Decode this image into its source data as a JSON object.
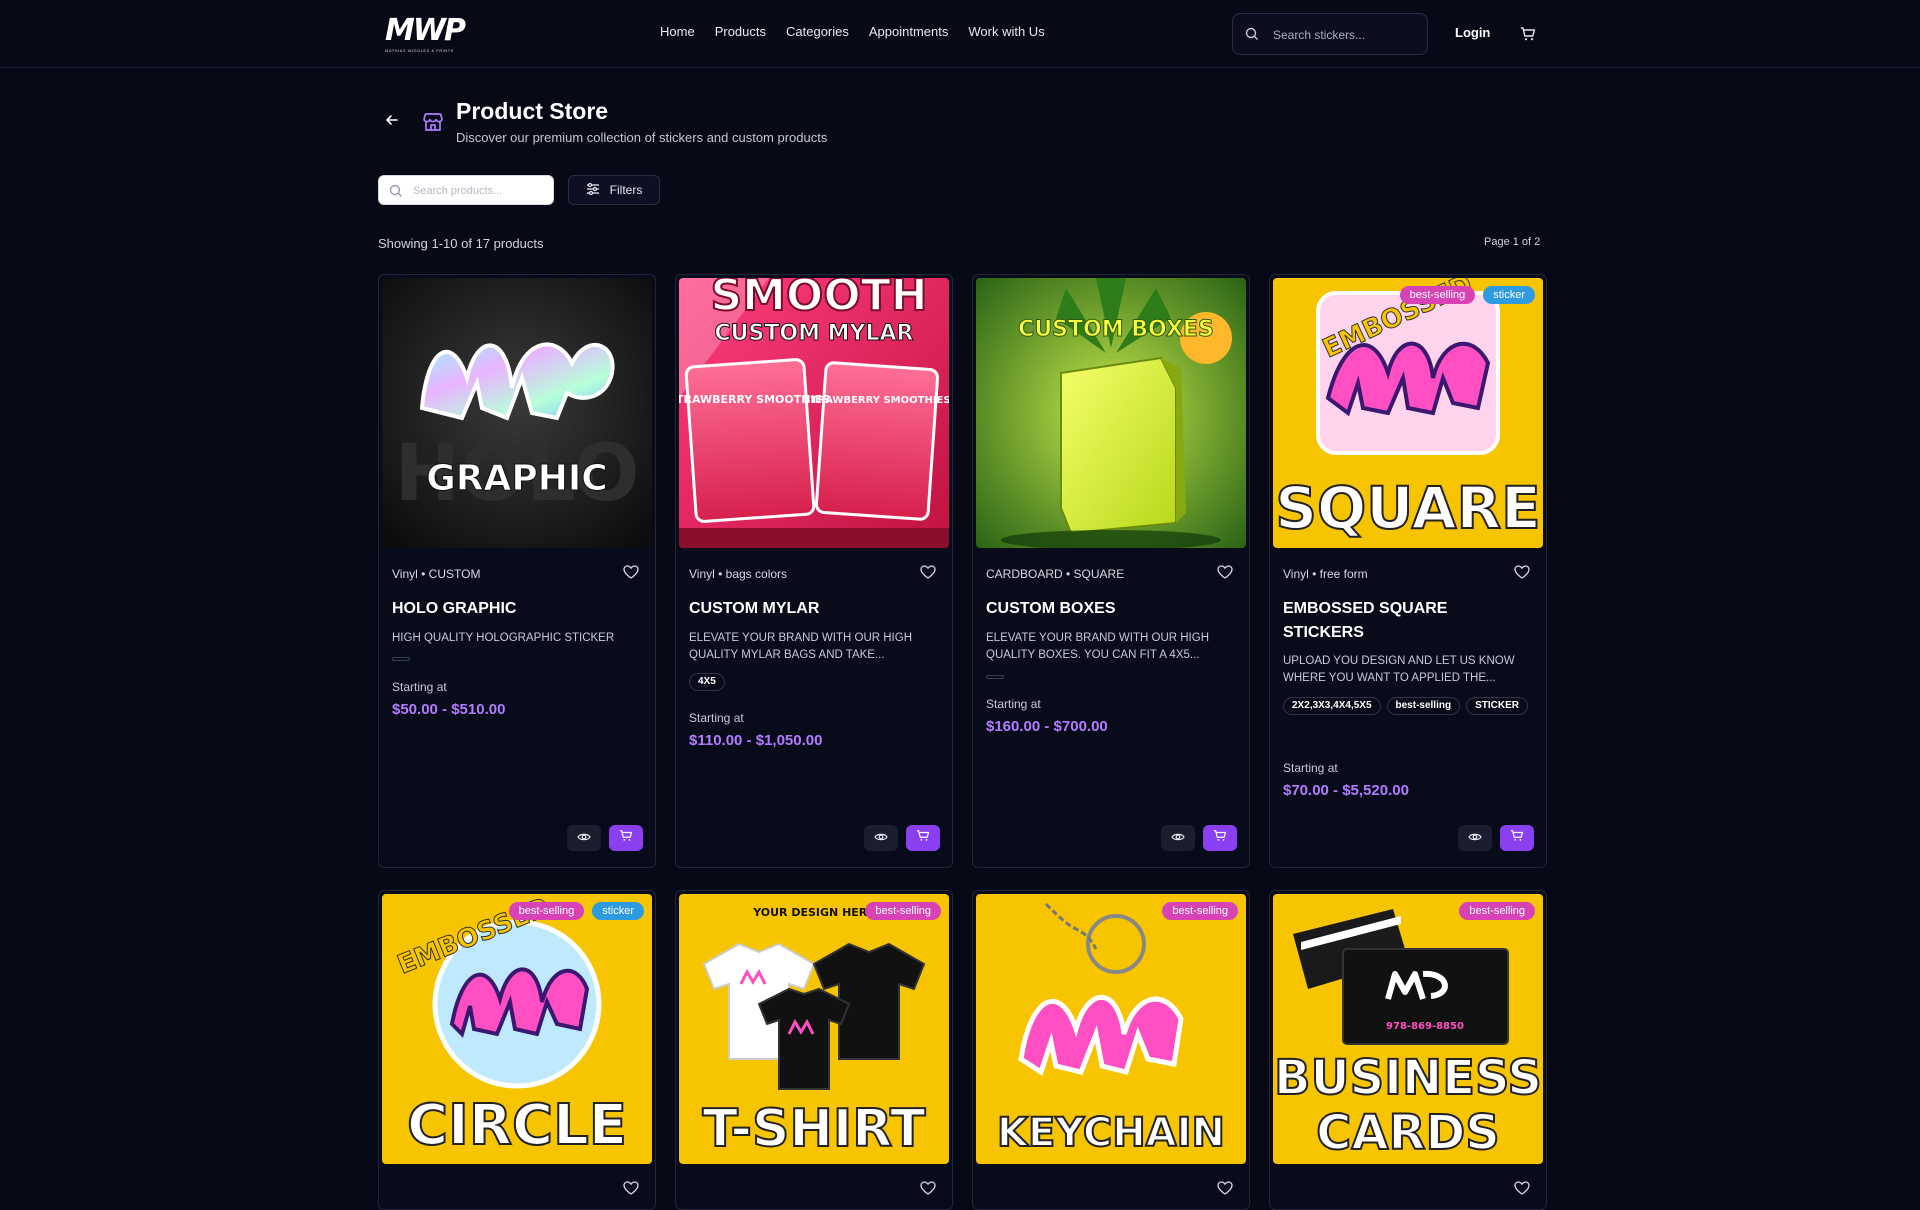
{
  "header": {
    "logo_text": "MWP",
    "logo_sub": "MATHIAS WIGGLES & PRINTS",
    "nav": [
      "Home",
      "Products",
      "Categories",
      "Appointments",
      "Work with Us"
    ],
    "search_placeholder": "Search stickers...",
    "login_label": "Login"
  },
  "page": {
    "title": "Product Store",
    "subtitle": "Discover our premium collection of stickers and custom products",
    "search_placeholder": "Search products...",
    "filters_label": "Filters",
    "showing": "Showing 1-10 of 17 products",
    "page_info": "Page 1 of 2"
  },
  "products": [
    {
      "image_text": "GRAPHIC",
      "image_bg_text": "HOLO",
      "badges": [],
      "meta": "Vinyl • CUSTOM",
      "name": "HOLO GRAPHIC",
      "description": "HIGH QUALITY HOLOGRAPHIC STICKER",
      "tags": [],
      "starting_label": "Starting at",
      "price": "$50.00 - $510.00"
    },
    {
      "image_text": "CUSTOM MYLAR",
      "image_bg_text": "SMOOTH",
      "image_sub": "STRAWBERRY SMOOTHIES",
      "badges": [],
      "meta": "Vinyl • bags colors",
      "name": "CUSTOM MYLAR",
      "description": "ELEVATE YOUR BRAND WITH OUR HIGH QUALITY MYLAR BAGS AND TAKE...",
      "tags": [
        "4X5"
      ],
      "starting_label": "Starting at",
      "price": "$110.00 - $1,050.00"
    },
    {
      "image_text": "CUSTOM BOXES",
      "badges": [],
      "meta": "CARDBOARD • SQUARE",
      "name": "CUSTOM BOXES",
      "description": "ELEVATE YOUR BRAND WITH OUR HIGH QUALITY BOXES. YOU CAN FIT A 4X5...",
      "tags": [],
      "starting_label": "Starting at",
      "price": "$160.00 - $700.00"
    },
    {
      "image_text": "SQUARE",
      "image_top_text": "EMBOSSED",
      "badges": [
        "best-selling",
        "sticker"
      ],
      "meta": "Vinyl • free form",
      "name": "EMBOSSED SQUARE STICKERS",
      "description": "UPLOAD YOU DESIGN AND LET US KNOW WHERE YOU WANT TO APPLIED THE...",
      "tags": [
        "2X2,3X3,4X4,5X5",
        "best-selling",
        "STICKER"
      ],
      "starting_label": "Starting at",
      "price": "$70.00 - $5,520.00"
    },
    {
      "image_text": "CIRCLE",
      "image_top_text": "EMBOSSED",
      "badges": [
        "best-selling",
        "sticker"
      ]
    },
    {
      "image_text": "T-SHIRT",
      "image_top_text": "YOUR DESIGN HERE",
      "badges": [
        "best-selling"
      ]
    },
    {
      "image_text": "KEYCHAIN",
      "badges": [
        "best-selling"
      ]
    },
    {
      "image_text": "BUSINESS CARDS",
      "image_line1": "BUSINESS",
      "image_line2": "CARDS",
      "image_phone": "978-869-8850",
      "badges": [
        "best-selling"
      ]
    }
  ],
  "colors": {
    "background": "#070917",
    "accent": "#8a3ff0",
    "price": "#b57bff",
    "badge_best_selling": "#d743b5",
    "badge_sticker": "#2e9be0",
    "yellow": "#f7c400"
  }
}
